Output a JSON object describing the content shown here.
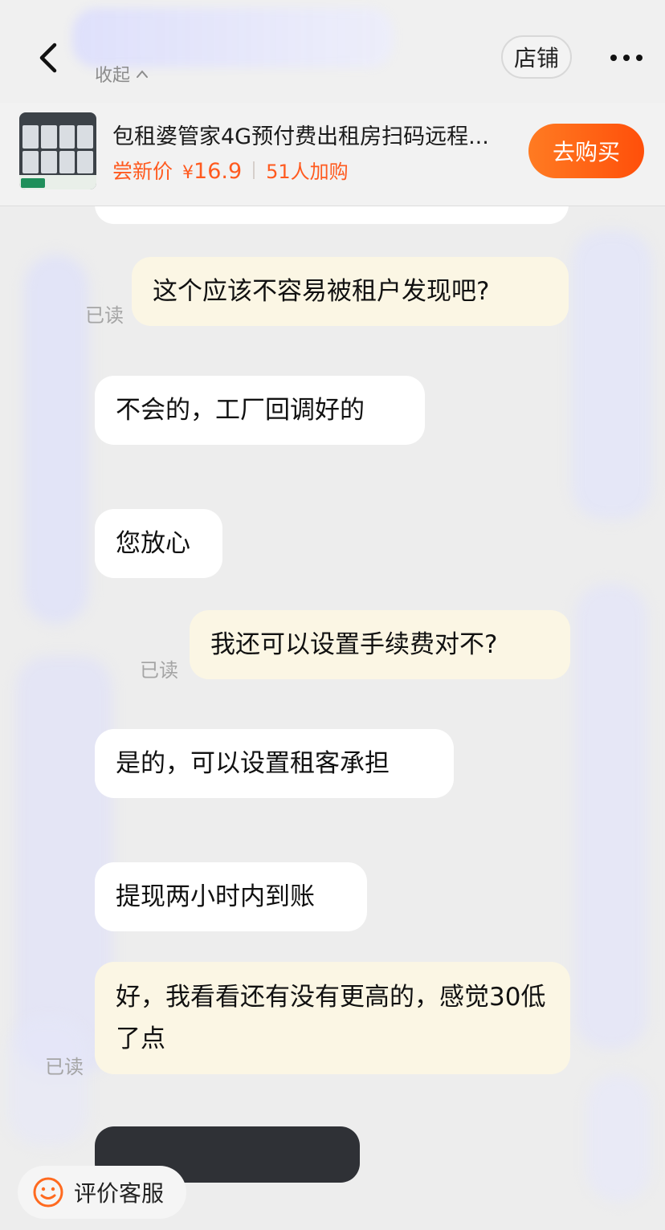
{
  "header": {
    "collapse_label": "收起",
    "shop_label": "店铺"
  },
  "product": {
    "title": "包租婆管家4G预付费出租房扫码远程...",
    "price_label": "尝新价",
    "currency": "¥",
    "price": "16.9",
    "added_count": "51人加购",
    "buy_label": "去购买"
  },
  "messages": [
    {
      "from": "me",
      "text": "这个应该不容易被租户发现吧?",
      "read": "已读"
    },
    {
      "from": "them",
      "text": "不会的，工厂回调好的"
    },
    {
      "from": "them",
      "text": "您放心"
    },
    {
      "from": "me",
      "text": "我还可以设置手续费对不?",
      "read": "已读"
    },
    {
      "from": "them",
      "text": "是的，可以设置租客承担"
    },
    {
      "from": "them",
      "text": "提现两小时内到账"
    },
    {
      "from": "me",
      "text": "好，我看看还有没有更高的，感觉30低了点",
      "read": "已读"
    }
  ],
  "footer": {
    "review_label": "评价客服"
  },
  "colors": {
    "accent": "#ff5a1f",
    "my_bubble": "#fbf6e4",
    "their_bubble": "#ffffff",
    "background": "#ededed"
  }
}
